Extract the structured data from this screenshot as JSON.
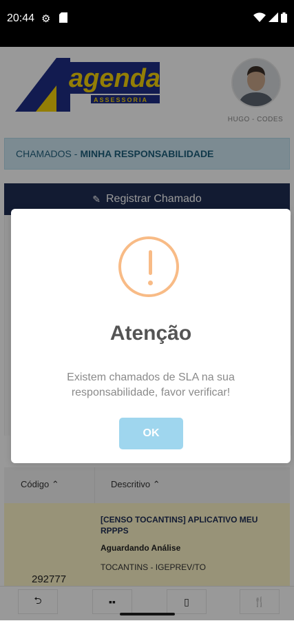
{
  "status_bar": {
    "time": "20:44",
    "icons": [
      "settings-icon",
      "sd-card-icon",
      "wifi-icon",
      "signal-icon",
      "battery-icon"
    ]
  },
  "header": {
    "logo_text": "agenda",
    "logo_sub": "ASSESSORIA",
    "user_name": "HUGO - CODES"
  },
  "breadcrumb": {
    "prefix": "CHAMADOS - ",
    "current": "MINHA RESPONSABILIDADE"
  },
  "register_button": {
    "label": "Registrar Chamado",
    "icon": "pencil-icon"
  },
  "table": {
    "headers": [
      {
        "label": "Código",
        "sort": "asc"
      },
      {
        "label": "Descritivo",
        "sort": "asc"
      }
    ],
    "rows": [
      {
        "code": "292777",
        "title": "[CENSO TOCANTINS] APLICATIVO MEU RPPPS",
        "status": "Aguardando Análise",
        "org": "TOCANTINS - IGEPREV/TO"
      }
    ]
  },
  "bottom_nav": {
    "items": [
      "back-icon",
      "grid-icon",
      "document-icon",
      "restaurant-icon"
    ]
  },
  "modal": {
    "icon": "warning-icon",
    "title": "Atenção",
    "message": "Existem chamados de SLA na sua responsabilidade, favor verificar!",
    "ok_label": "OK"
  },
  "colors": {
    "navy": "#1e2d54",
    "warning": "#f8bb86",
    "ok_button": "#9fd6ee",
    "breadcrumb_bg": "#cfe8f3",
    "row_highlight": "#fdf5c9"
  }
}
